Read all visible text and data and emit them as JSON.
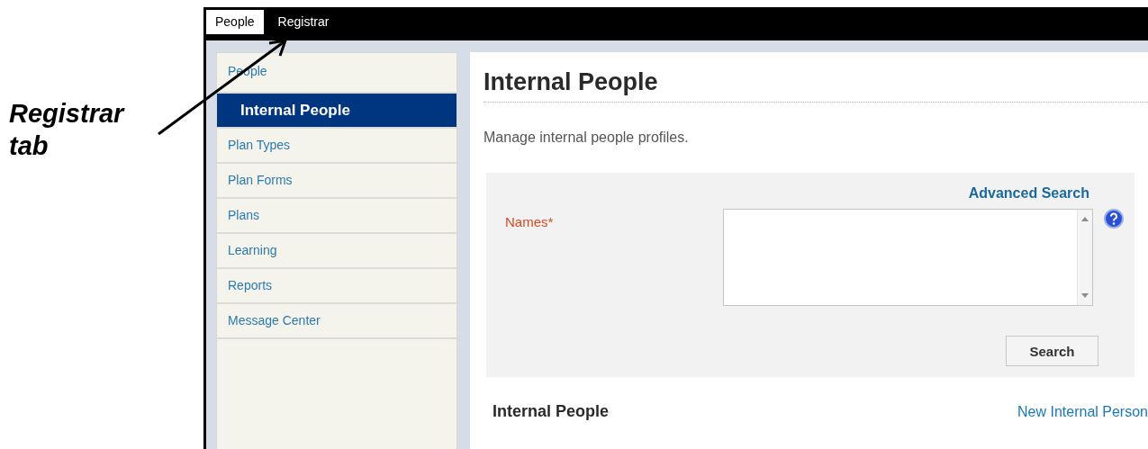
{
  "annotation": {
    "text": "Registrar tab"
  },
  "tabs": [
    {
      "label": "People",
      "selected": true
    },
    {
      "label": "Registrar",
      "selected": false
    }
  ],
  "sidebar": {
    "items": [
      {
        "label": "People",
        "kind": "group",
        "selected": false
      },
      {
        "label": "Internal People",
        "kind": "child",
        "selected": true
      },
      {
        "label": "Plan Types",
        "kind": "group",
        "selected": false
      },
      {
        "label": "Plan Forms",
        "kind": "group",
        "selected": false
      },
      {
        "label": "Plans",
        "kind": "group",
        "selected": false
      },
      {
        "label": "Learning",
        "kind": "group",
        "selected": false
      },
      {
        "label": "Reports",
        "kind": "group",
        "selected": false
      },
      {
        "label": "Message Center",
        "kind": "group",
        "selected": false
      }
    ]
  },
  "main": {
    "title": "Internal People",
    "description": "Manage internal people profiles.",
    "search_panel": {
      "advanced_link": "Advanced Search",
      "field_label": "Names*",
      "search_button": "Search"
    },
    "results": {
      "title": "Internal People",
      "new_link": "New Internal Person"
    }
  }
}
